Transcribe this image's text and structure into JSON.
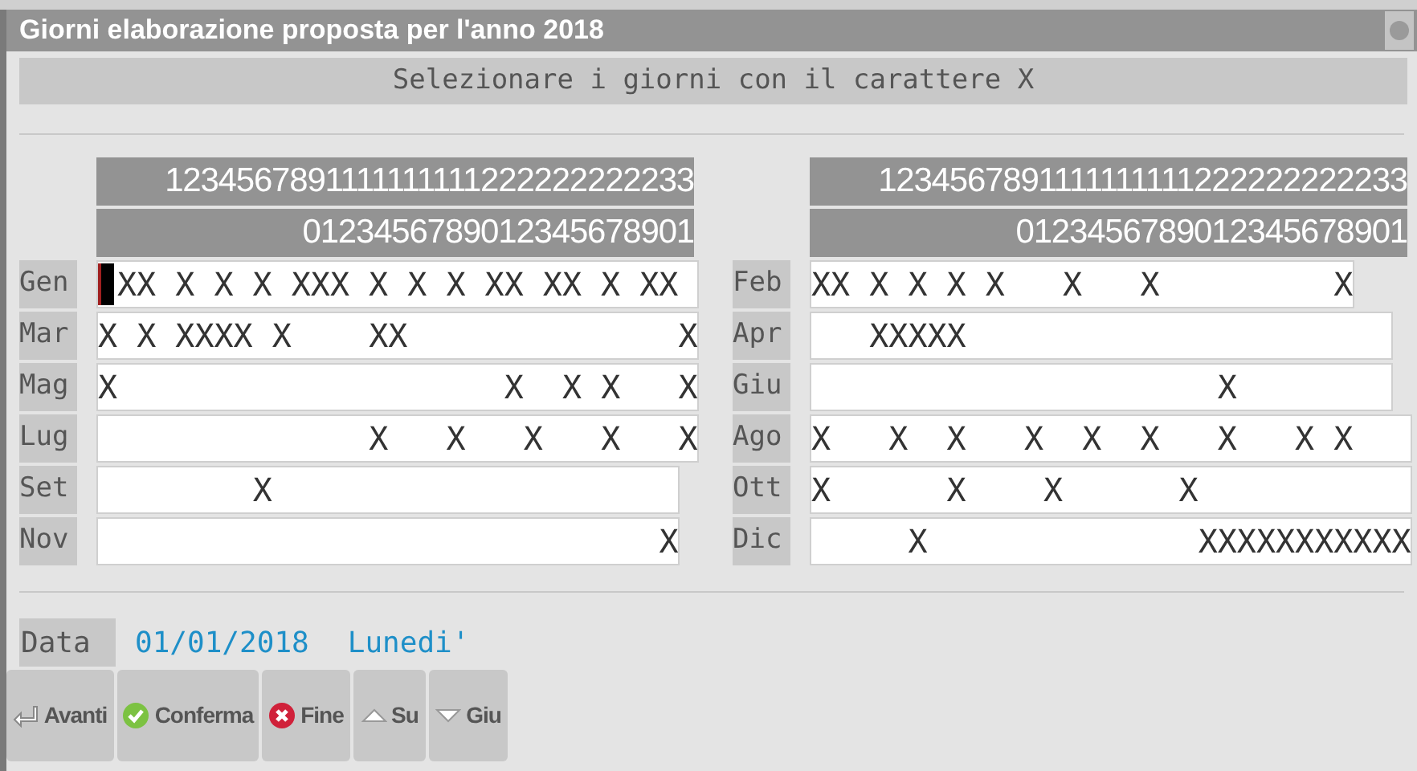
{
  "window": {
    "title": "Giorni elaborazione proposta per l'anno 2018"
  },
  "instruction": "Selezionare i giorni con il carattere X",
  "columns": [
    {
      "header_tens": "1234567891111111111222222222233",
      "header_units": "0123456789012345678901",
      "months": [
        {
          "label": "Gen",
          "value": "XX X X X XXX X X X XX XX X XX ",
          "focused": true
        },
        {
          "label": "Mar",
          "value": "X X XXXX X    XX              X",
          "focused": false
        },
        {
          "label": "Mag",
          "value": "X                    X  X X   X",
          "focused": false
        },
        {
          "label": "Lug",
          "value": "              X   X   X   X   X",
          "focused": false
        },
        {
          "label": "Set",
          "value": "        X                     ",
          "focused": false
        },
        {
          "label": "Nov",
          "value": "                             X",
          "focused": false
        }
      ]
    },
    {
      "header_tens": "1234567891111111111222222222233",
      "header_units": "0123456789012345678901",
      "months": [
        {
          "label": "Feb",
          "value": "XX X X X X   X   X         X",
          "focused": false
        },
        {
          "label": "Apr",
          "value": "   XXXXX                      ",
          "focused": false
        },
        {
          "label": "Giu",
          "value": "                     X        ",
          "focused": false
        },
        {
          "label": "Ago",
          "value": "X   X  X   X  X  X   X   X X   ",
          "focused": false
        },
        {
          "label": "Ott",
          "value": "X      X    X      X           ",
          "focused": false
        },
        {
          "label": "Dic",
          "value": "     X              XXXXXXXXXXX",
          "focused": false
        }
      ]
    }
  ],
  "date": {
    "label": "Data",
    "value": "01/01/2018",
    "weekday": "Lunedi'"
  },
  "buttons": [
    {
      "kind": "enter",
      "label": "Avanti"
    },
    {
      "kind": "confirm",
      "label": "Conferma"
    },
    {
      "kind": "end",
      "label": "Fine"
    },
    {
      "kind": "up",
      "label": "Su"
    },
    {
      "kind": "down",
      "label": "Giu"
    }
  ]
}
